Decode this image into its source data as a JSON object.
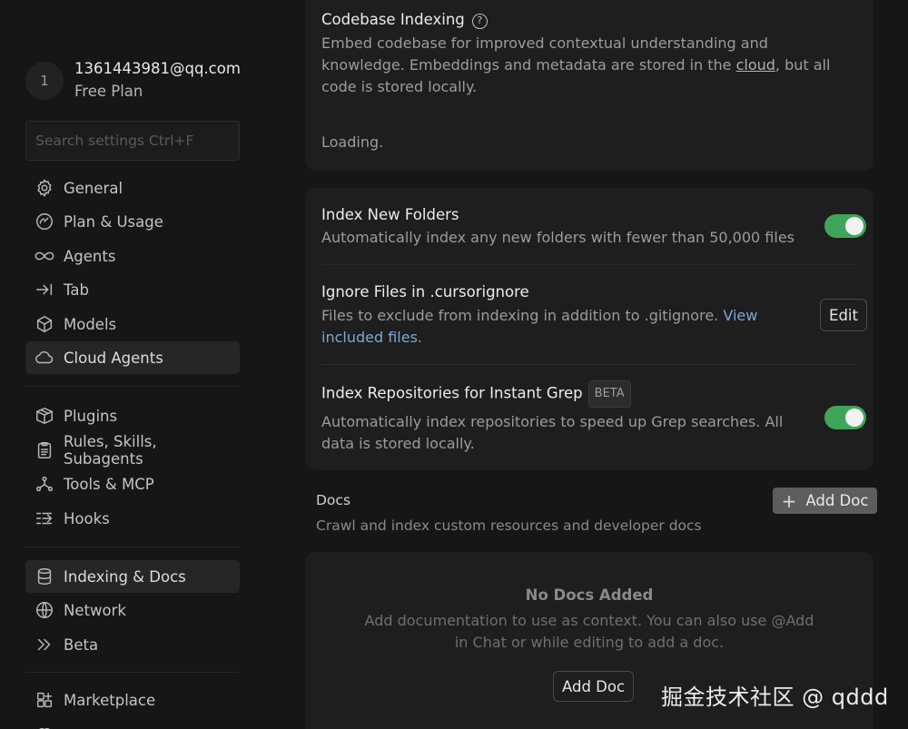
{
  "account": {
    "avatar_initial": "1",
    "email": "1361443981@qq.com",
    "plan": "Free Plan"
  },
  "search": {
    "placeholder": "Search settings Ctrl+F"
  },
  "nav": {
    "general": "General",
    "plan_usage": "Plan & Usage",
    "agents": "Agents",
    "tab": "Tab",
    "models": "Models",
    "cloud_agents": "Cloud Agents",
    "plugins": "Plugins",
    "rules": "Rules, Skills, Subagents",
    "tools_mcp": "Tools & MCP",
    "hooks": "Hooks",
    "indexing_docs": "Indexing & Docs",
    "network": "Network",
    "beta": "Beta",
    "marketplace": "Marketplace",
    "active_item": "Indexing & Docs"
  },
  "codebase": {
    "title": "Codebase Indexing",
    "help_glyph": "?",
    "desc_before_link": "Embed codebase for improved contextual understanding and knowledge. Embeddings and metadata are stored in the ",
    "desc_link": "cloud",
    "desc_after_link": ", but all code is stored locally.",
    "status": "Loading."
  },
  "settings": {
    "index_new_folders": {
      "title": "Index New Folders",
      "desc": "Automatically index any new folders with fewer than 50,000 files",
      "enabled": true
    },
    "ignore_files": {
      "title": "Ignore Files in .cursorignore",
      "desc_before_link": "Files to exclude from indexing in addition to .gitignore. ",
      "desc_link": "View included files.",
      "button": "Edit"
    },
    "instant_grep": {
      "title": "Index Repositories for Instant Grep",
      "badge": "BETA",
      "desc": "Automatically index repositories to speed up Grep searches. All data is stored locally.",
      "enabled": true
    }
  },
  "docs": {
    "title": "Docs",
    "subtitle": "Crawl and index custom resources and developer docs",
    "add_button_icon": "+",
    "add_button": "Add Doc",
    "empty_title": "No Docs Added",
    "empty_desc": "Add documentation to use as context. You can also use @Add in Chat or while editing to add a doc.",
    "empty_button": "Add Doc"
  },
  "watermark": "掘金技术社区 @ qddd",
  "colors": {
    "toggle_on": "#3fa55b",
    "link": "#7fa6d6",
    "background": "#161616",
    "card": "#1e1e1e"
  }
}
